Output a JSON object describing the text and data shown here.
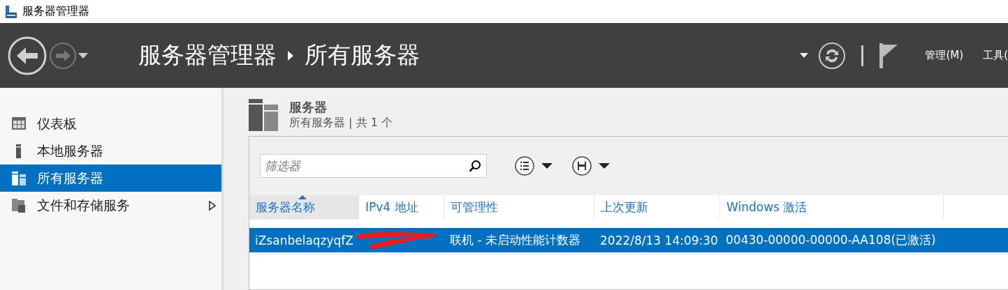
{
  "window": {
    "title": "服务器管理器"
  },
  "header": {
    "breadcrumb": [
      "服务器管理器",
      "所有服务器"
    ],
    "menus": [
      "管理(M)",
      "工具("
    ]
  },
  "sidebar": {
    "items": [
      {
        "label": "仪表板",
        "kind": "dashboard",
        "selected": false,
        "expandable": false
      },
      {
        "label": "本地服务器",
        "kind": "local",
        "selected": false,
        "expandable": false
      },
      {
        "label": "所有服务器",
        "kind": "all",
        "selected": true,
        "expandable": false
      },
      {
        "label": "文件和存储服务",
        "kind": "files",
        "selected": false,
        "expandable": true
      }
    ]
  },
  "panel": {
    "title": "服务器",
    "subtitle": "所有服务器 | 共 1 个",
    "filter": {
      "placeholder": "筛选器"
    },
    "table": {
      "columns": [
        {
          "label": "服务器名称",
          "sorted": true
        },
        {
          "label": "IPv4 地址",
          "sorted": false
        },
        {
          "label": "可管理性",
          "sorted": false
        },
        {
          "label": "上次更新",
          "sorted": false
        },
        {
          "label": "Windows 激活",
          "sorted": false
        }
      ],
      "rows": [
        {
          "selected": true,
          "cells": [
            "iZsanbelaqzyqfZ",
            "",
            "联机 - 未启动性能计数器",
            "2022/8/13 14:09:30",
            "00430-00000-00000-AA108(已激活)"
          ]
        }
      ]
    }
  }
}
